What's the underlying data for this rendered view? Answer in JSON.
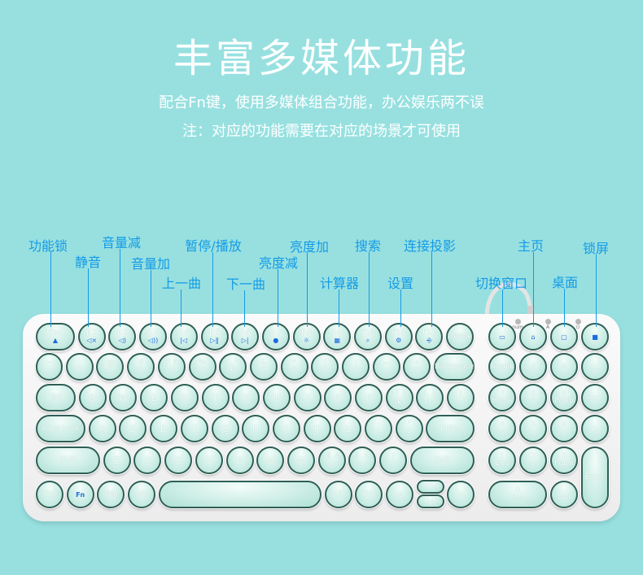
{
  "title": "丰富多媒体功能",
  "subtitle_1": "配合Fn键，使用多媒体组合功能，办公娱乐两不误",
  "subtitle_2": "注：对应的功能需要在对应的场景才可使用",
  "colors": {
    "background": "#98e0e0",
    "callout": "#149be6",
    "key_border": "#2f5e55",
    "icon": "#1d6be0"
  },
  "callouts": [
    "功能锁",
    "静音",
    "音量减",
    "音量加",
    "上一曲",
    "暂停/播放",
    "下一曲",
    "亮度减",
    "亮度加",
    "计算器",
    "搜索",
    "设置",
    "连接投影",
    "切换窗口",
    "主页",
    "桌面",
    "锁屏"
  ],
  "indicators": [
    "num",
    "A",
    "⏻"
  ],
  "keyboard": {
    "rows": [
      [
        {
          "l": "Esc",
          "i": "lock"
        },
        {
          "l": "F1",
          "i": "mute"
        },
        {
          "l": "F2",
          "i": "volume-down"
        },
        {
          "l": "F3",
          "i": "volume-up"
        },
        {
          "l": "F4",
          "i": "previous"
        },
        {
          "l": "F5",
          "i": "play-pause"
        },
        {
          "l": "F6",
          "i": "next"
        },
        {
          "l": "F7",
          "i": "brightness-down"
        },
        {
          "l": "F8",
          "i": "brightness-up"
        },
        {
          "l": "F9",
          "i": "calculator"
        },
        {
          "l": "F10",
          "i": "search"
        },
        {
          "l": "F11",
          "i": "settings"
        },
        {
          "l": "F12",
          "i": "projection"
        },
        {
          "l": "Delete"
        }
      ],
      [
        {
          "l": "~",
          "s": "、·"
        },
        {
          "l": "!",
          "s": "1"
        },
        {
          "l": "@",
          "s": "2"
        },
        {
          "l": "#",
          "s": "3"
        },
        {
          "l": "¥ $",
          "s": "4"
        },
        {
          "l": "%",
          "s": "5"
        },
        {
          "l": "…^",
          "s": "6"
        },
        {
          "l": "&",
          "s": "7"
        },
        {
          "l": "*",
          "s": "8"
        },
        {
          "l": "(",
          "s": "9"
        },
        {
          "l": ")",
          "s": "0"
        },
        {
          "l": "—",
          "s": "-"
        },
        {
          "l": "+",
          "s": "="
        },
        {
          "l": "Backspace"
        }
      ],
      [
        {
          "l": "Tab"
        },
        {
          "l": "Q"
        },
        {
          "l": "W"
        },
        {
          "l": "E"
        },
        {
          "l": "R"
        },
        {
          "l": "T"
        },
        {
          "l": "Y"
        },
        {
          "l": "U"
        },
        {
          "l": "I"
        },
        {
          "l": "O"
        },
        {
          "l": "P"
        },
        {
          "l": "「 {",
          "s": "【 ["
        },
        {
          "l": "」 }",
          "s": "】 ]"
        },
        {
          "l": "|",
          "s": "、 \\"
        }
      ],
      [
        {
          "l": "Caps Lock"
        },
        {
          "l": "A"
        },
        {
          "l": "S"
        },
        {
          "l": "D"
        },
        {
          "l": "F"
        },
        {
          "l": "G"
        },
        {
          "l": "H"
        },
        {
          "l": "J"
        },
        {
          "l": "K"
        },
        {
          "l": "L"
        },
        {
          "l": ":",
          "s": ";"
        },
        {
          "l": "\"",
          "s": "'"
        },
        {
          "l": "Enter"
        }
      ],
      [
        {
          "l": "Shift"
        },
        {
          "l": "Z"
        },
        {
          "l": "X"
        },
        {
          "l": "C"
        },
        {
          "l": "V"
        },
        {
          "l": "B"
        },
        {
          "l": "N"
        },
        {
          "l": "M"
        },
        {
          "l": "《 <",
          "s": "，,"
        },
        {
          "l": "》 >",
          "s": "。."
        },
        {
          "l": "?",
          "s": "/"
        },
        {
          "l": "Shift"
        }
      ],
      [
        {
          "l": "Ctrl"
        },
        {
          "l": "Fn"
        },
        {
          "l": "Win"
        },
        {
          "l": "Alt"
        },
        {
          "l": ""
        },
        {
          "l": "Alt"
        },
        {
          "l": "Ctrl"
        },
        {
          "l": "<"
        },
        {
          "l": "^"
        },
        {
          "l": "v"
        },
        {
          "l": ">"
        }
      ]
    ],
    "numpad": [
      [
        {
          "i": "window-switch"
        },
        {
          "i": "home"
        },
        {
          "i": "desktop"
        },
        {
          "i": "lock-screen"
        }
      ],
      [
        {
          "l": "Numlk"
        },
        {
          "l": "/"
        },
        {
          "l": "*"
        },
        {
          "l": "−"
        }
      ],
      [
        {
          "l": "7",
          "s": "Home"
        },
        {
          "l": "8",
          "s": "^"
        },
        {
          "l": "9",
          "s": "PgUp"
        },
        {
          "l": "+"
        }
      ],
      [
        {
          "l": "4",
          "s": "<"
        },
        {
          "l": "5",
          "s": "_"
        },
        {
          "l": "6",
          "s": ">"
        },
        {
          "l": "←"
        }
      ],
      [
        {
          "l": "1",
          "s": "End"
        },
        {
          "l": "2",
          "s": "v"
        },
        {
          "l": "3",
          "s": "PgDn"
        },
        {
          "l": "Enter"
        }
      ],
      [
        {
          "l": "0",
          "s": "Ins"
        },
        {
          "l": ".",
          "s": "Del"
        }
      ]
    ]
  }
}
